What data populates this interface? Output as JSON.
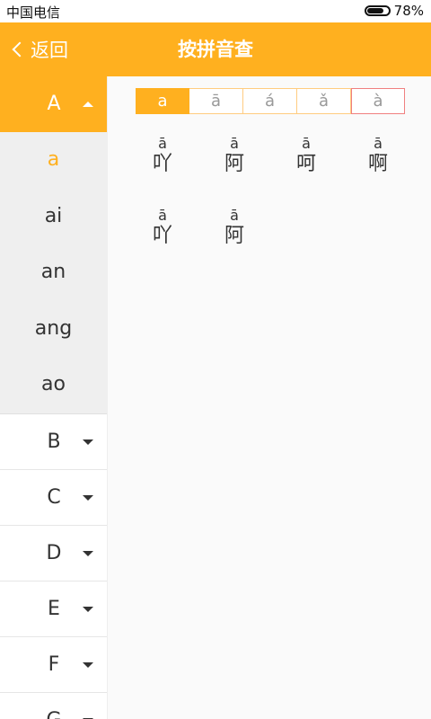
{
  "status_bar": {
    "carrier": "中国电信",
    "battery_percent": 78,
    "battery_text": "78%"
  },
  "header": {
    "back_label": "返回",
    "title": "按拼音查"
  },
  "sidebar": {
    "expanded_letter": "A",
    "expanded_syllables": [
      "a",
      "ai",
      "an",
      "ang",
      "ao"
    ],
    "selected_syllable": "a",
    "collapsed_letters": [
      "B",
      "C",
      "D",
      "E",
      "F",
      "G"
    ]
  },
  "tone_tabs": [
    {
      "label": "a",
      "active": true
    },
    {
      "label": "ā",
      "active": false
    },
    {
      "label": "á",
      "active": false
    },
    {
      "label": "ǎ",
      "active": false
    },
    {
      "label": "à",
      "active": false
    }
  ],
  "characters": [
    {
      "pinyin": "ā",
      "hanzi": "吖"
    },
    {
      "pinyin": "ā",
      "hanzi": "阿"
    },
    {
      "pinyin": "ā",
      "hanzi": "呵"
    },
    {
      "pinyin": "ā",
      "hanzi": "啊"
    },
    {
      "pinyin": "ā",
      "hanzi": "吖"
    },
    {
      "pinyin": "ā",
      "hanzi": "阿"
    }
  ],
  "colors": {
    "accent": "#ffb01f",
    "selected_tab_border": "#f08080"
  }
}
